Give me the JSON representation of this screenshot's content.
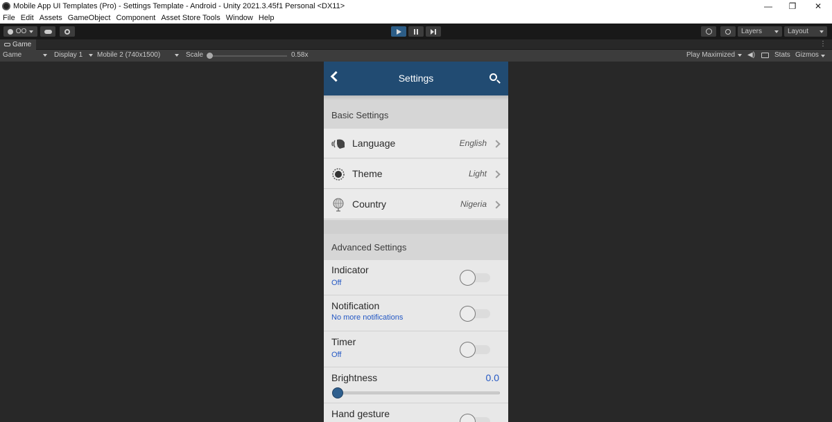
{
  "window": {
    "title": "Mobile App UI Templates (Pro) - Settings Template - Android - Unity 2021.3.45f1 Personal <DX11>",
    "minimize": "—",
    "maximize": "❐",
    "close": "✕"
  },
  "menu": [
    "File",
    "Edit",
    "Assets",
    "GameObject",
    "Component",
    "Asset Store Tools",
    "Window",
    "Help"
  ],
  "toolbar": {
    "account_label": "OO",
    "layers_label": "Layers",
    "layout_label": "Layout"
  },
  "game_tab": {
    "label": "Game",
    "kebab": "⋮"
  },
  "game_bar": {
    "view_select": "Game",
    "display_select": "Display 1",
    "resolution_select": "Mobile 2 (740x1500)",
    "scale_label": "Scale",
    "scale_value": "0.58x",
    "play_mode_select": "Play Maximized",
    "stats_label": "Stats",
    "gizmos_label": "Gizmos"
  },
  "app": {
    "header_title": "Settings",
    "basic_section": "Basic Settings",
    "basic_rows": [
      {
        "label": "Language",
        "value": "English",
        "icon": "language-icon"
      },
      {
        "label": "Theme",
        "value": "Light",
        "icon": "theme-icon"
      },
      {
        "label": "Country",
        "value": "Nigeria",
        "icon": "globe-icon"
      }
    ],
    "advanced_section": "Advanced Settings",
    "toggles": [
      {
        "label": "Indicator",
        "sub": "Off",
        "on": false
      },
      {
        "label": "Notification",
        "sub": "No more notifications",
        "on": false
      },
      {
        "label": "Timer",
        "sub": "Off",
        "on": false
      }
    ],
    "brightness": {
      "label": "Brightness",
      "value": "0.0",
      "fraction": 0.0
    },
    "hand_gesture": {
      "label": "Hand gesture",
      "on": false
    }
  },
  "colors": {
    "header": "#214b72",
    "accent_text": "#2458c4",
    "play_active": "#2c5d87"
  }
}
